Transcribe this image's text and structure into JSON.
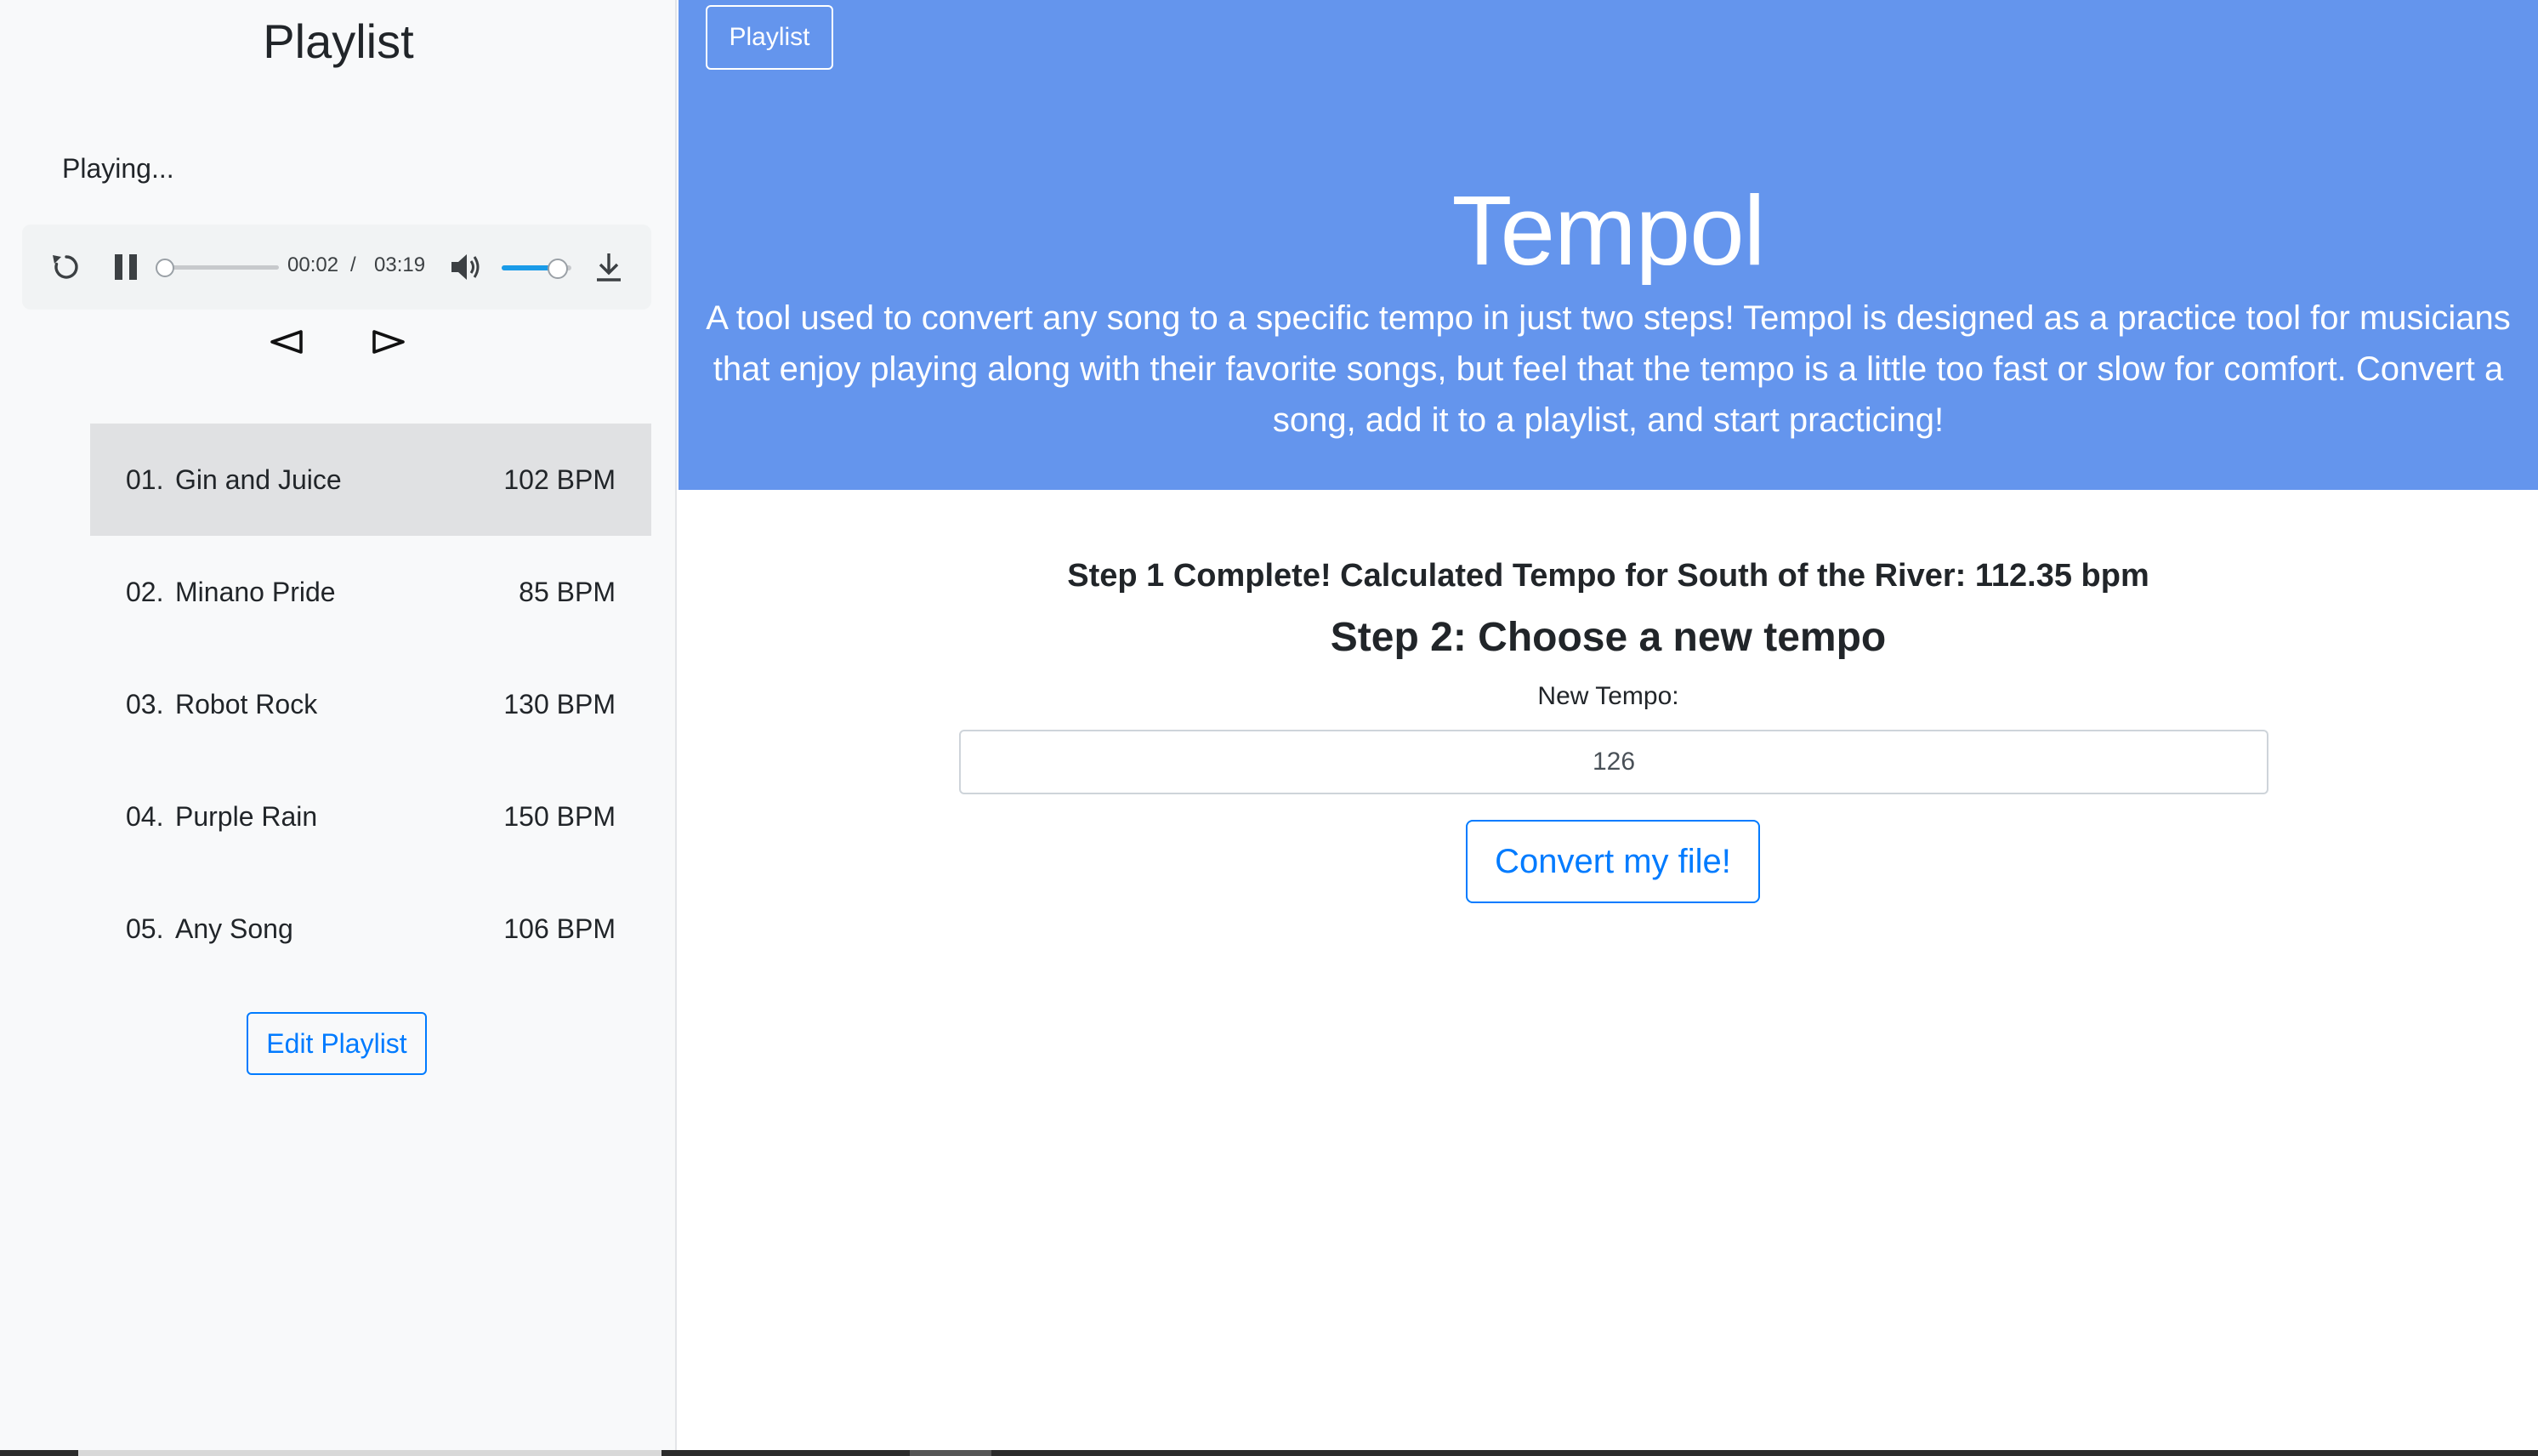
{
  "sidebar": {
    "title": "Playlist",
    "status": "Playing...",
    "player": {
      "current_time": "00:02",
      "separator": "/",
      "total_time": "03:19",
      "progress": 0.01,
      "volume": 0.8
    },
    "songs": [
      {
        "num": "01.",
        "name": "Gin and Juice",
        "bpm": "102 BPM",
        "active": true
      },
      {
        "num": "02.",
        "name": "Minano Pride",
        "bpm": "85 BPM",
        "active": false
      },
      {
        "num": "03.",
        "name": "Robot Rock",
        "bpm": "130 BPM",
        "active": false
      },
      {
        "num": "04.",
        "name": "Purple Rain",
        "bpm": "150 BPM",
        "active": false
      },
      {
        "num": "05.",
        "name": "Any Song",
        "bpm": "106 BPM",
        "active": false
      }
    ],
    "edit_label": "Edit Playlist"
  },
  "hero": {
    "nav_label": "Playlist",
    "title": "Tempol",
    "description": "A tool used to convert any song to a specific tempo in just two steps! Tempol is designed as a practice tool for musicians that enjoy playing along with their favorite songs, but feel that the tempo is a little too fast or slow for comfort. Convert a song, add it to a playlist, and start practicing!",
    "color": "#6495ed"
  },
  "main": {
    "step1_text": "Step 1 Complete! Calculated Tempo for South of the River: 112.35 bpm",
    "step2_title": "Step 2: Choose a new tempo",
    "tempo_label": "New Tempo:",
    "tempo_value": "126",
    "convert_label": "Convert my file!"
  },
  "colors": {
    "accent": "#007bff",
    "volume_fill": "#1a9be8",
    "sidebar_bg": "#f8f9fa",
    "active_row": "#e0e1e3"
  }
}
